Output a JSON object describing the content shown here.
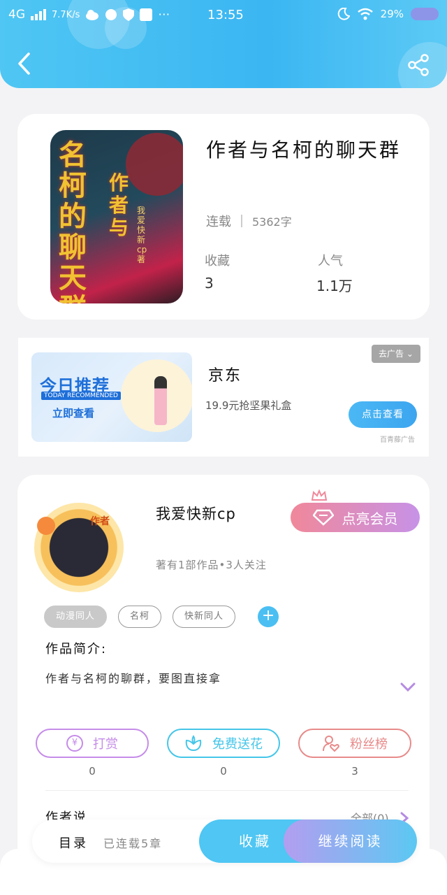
{
  "status_bar": {
    "network": "4G",
    "speed": "7.7K/s",
    "time": "13:55",
    "battery": "29%"
  },
  "book": {
    "title": "作者与名柯的聊天群",
    "status": "连载",
    "word_count": "5362字",
    "fav_label": "收藏",
    "fav_value": "3",
    "pop_label": "人气",
    "pop_value": "1.1万",
    "cover_title_main": "名柯的聊天群",
    "cover_title_side": "作者与",
    "cover_author": "我爱快新cp著"
  },
  "ad": {
    "close_label": "去广告",
    "image_heading": "今日推荐",
    "image_english": "TODAY RECOMMENDED",
    "image_button": "立即查看",
    "title": "京东",
    "subtitle": "19.9元抢坚果礼盒",
    "cta": "点击查看",
    "source": "百青藤广告"
  },
  "author": {
    "name": "我爱快新cp",
    "avatar_tag": "作者",
    "info": "著有1部作品•3人关注",
    "vip_label": "点亮会员",
    "tags": [
      "动漫同人",
      "名柯",
      "快新同人"
    ],
    "intro_label": "作品简介:",
    "intro_text": "作者与名柯的聊群，要图直接拿",
    "says_label": "作者说",
    "says_all": "全部(0)"
  },
  "actions": {
    "reward_label": "打赏",
    "reward_count": "0",
    "flower_label": "免费送花",
    "flower_count": "0",
    "fans_label": "粉丝榜",
    "fans_count": "3"
  },
  "bottom": {
    "toc_label": "目录",
    "toc_status": "已连载5章",
    "fav_button": "收藏",
    "read_button": "继续阅读"
  },
  "colors": {
    "header_blue": "#3bb6f2",
    "accent_blue": "#4bbff2",
    "reward_purple": "#c58ce8",
    "flower_cyan": "#45c6e8",
    "fans_red": "#e88a8a"
  }
}
